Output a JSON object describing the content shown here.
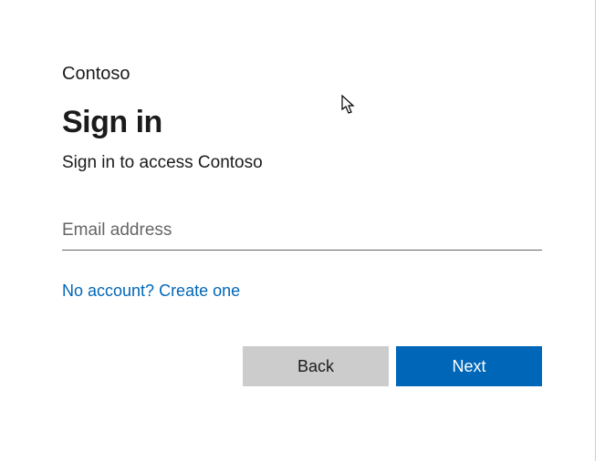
{
  "brand": "Contoso",
  "title": "Sign in",
  "subtitle": "Sign in to access Contoso",
  "email": {
    "placeholder": "Email address",
    "value": ""
  },
  "create_link": "No account? Create one",
  "buttons": {
    "back": "Back",
    "next": "Next"
  },
  "colors": {
    "primary": "#0067b8",
    "secondary": "#cccccc",
    "text": "#1b1b1b",
    "placeholder": "#666666"
  }
}
